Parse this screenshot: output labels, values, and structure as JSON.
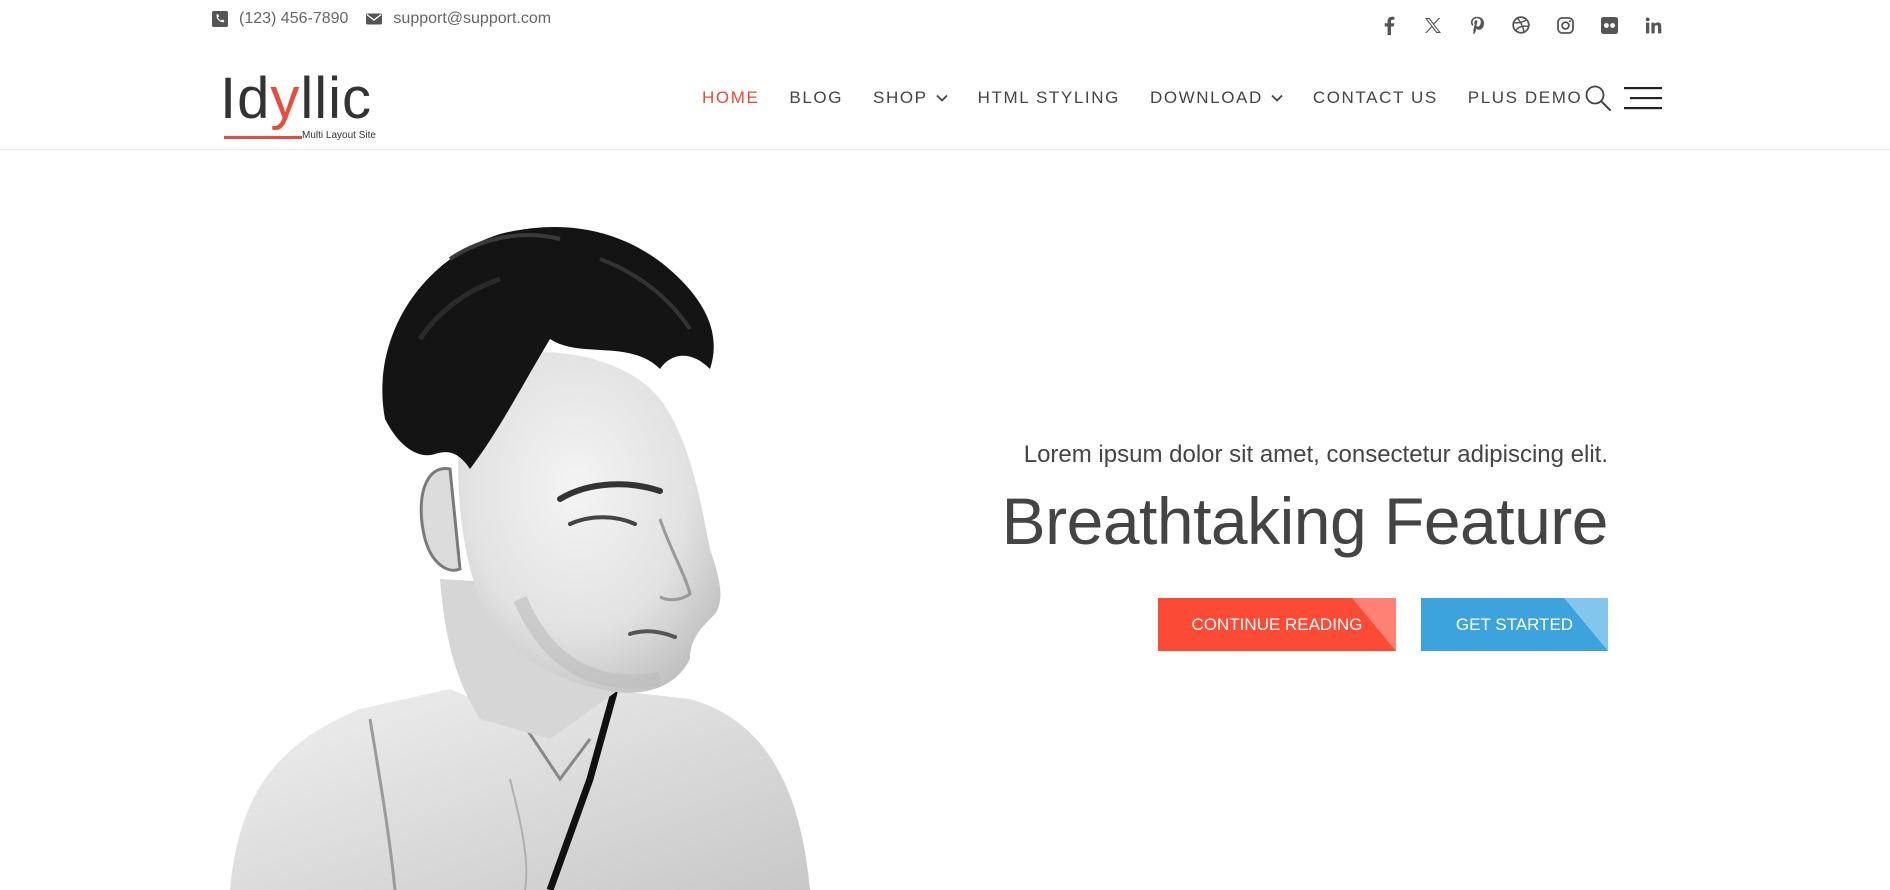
{
  "topbar": {
    "phone": "(123) 456-7890",
    "email": "support@support.com",
    "phone_icon": "phone-square-icon",
    "email_icon": "envelope-icon",
    "social": [
      "facebook-icon",
      "x-twitter-icon",
      "pinterest-icon",
      "dribbble-icon",
      "instagram-icon",
      "flickr-icon",
      "linkedin-icon"
    ]
  },
  "header": {
    "logo": {
      "prefix": "Id",
      "accent": "y",
      "suffix": "llic",
      "tagline": "Multi Layout Site"
    },
    "nav": [
      {
        "label": "HOME",
        "active": true,
        "dropdown": false
      },
      {
        "label": "BLOG",
        "active": false,
        "dropdown": false
      },
      {
        "label": "SHOP",
        "active": false,
        "dropdown": true
      },
      {
        "label": "HTML STYLING",
        "active": false,
        "dropdown": false
      },
      {
        "label": "DOWNLOAD",
        "active": false,
        "dropdown": true
      },
      {
        "label": "CONTACT US",
        "active": false,
        "dropdown": false
      },
      {
        "label": "PLUS DEMO",
        "active": false,
        "dropdown": false
      }
    ],
    "search_icon": "search-icon",
    "menu_icon": "hamburger-menu-icon"
  },
  "hero": {
    "subtitle": "Lorem ipsum dolor sit amet, consectetur adipiscing elit.",
    "title": "Breathtaking Feature",
    "buttons": {
      "primary": "CONTINUE READING",
      "secondary": "GET STARTED"
    }
  },
  "colors": {
    "accent": "#e44b37",
    "button_red": "#fb4a35",
    "button_blue": "#3da3dc",
    "text": "#444444"
  }
}
